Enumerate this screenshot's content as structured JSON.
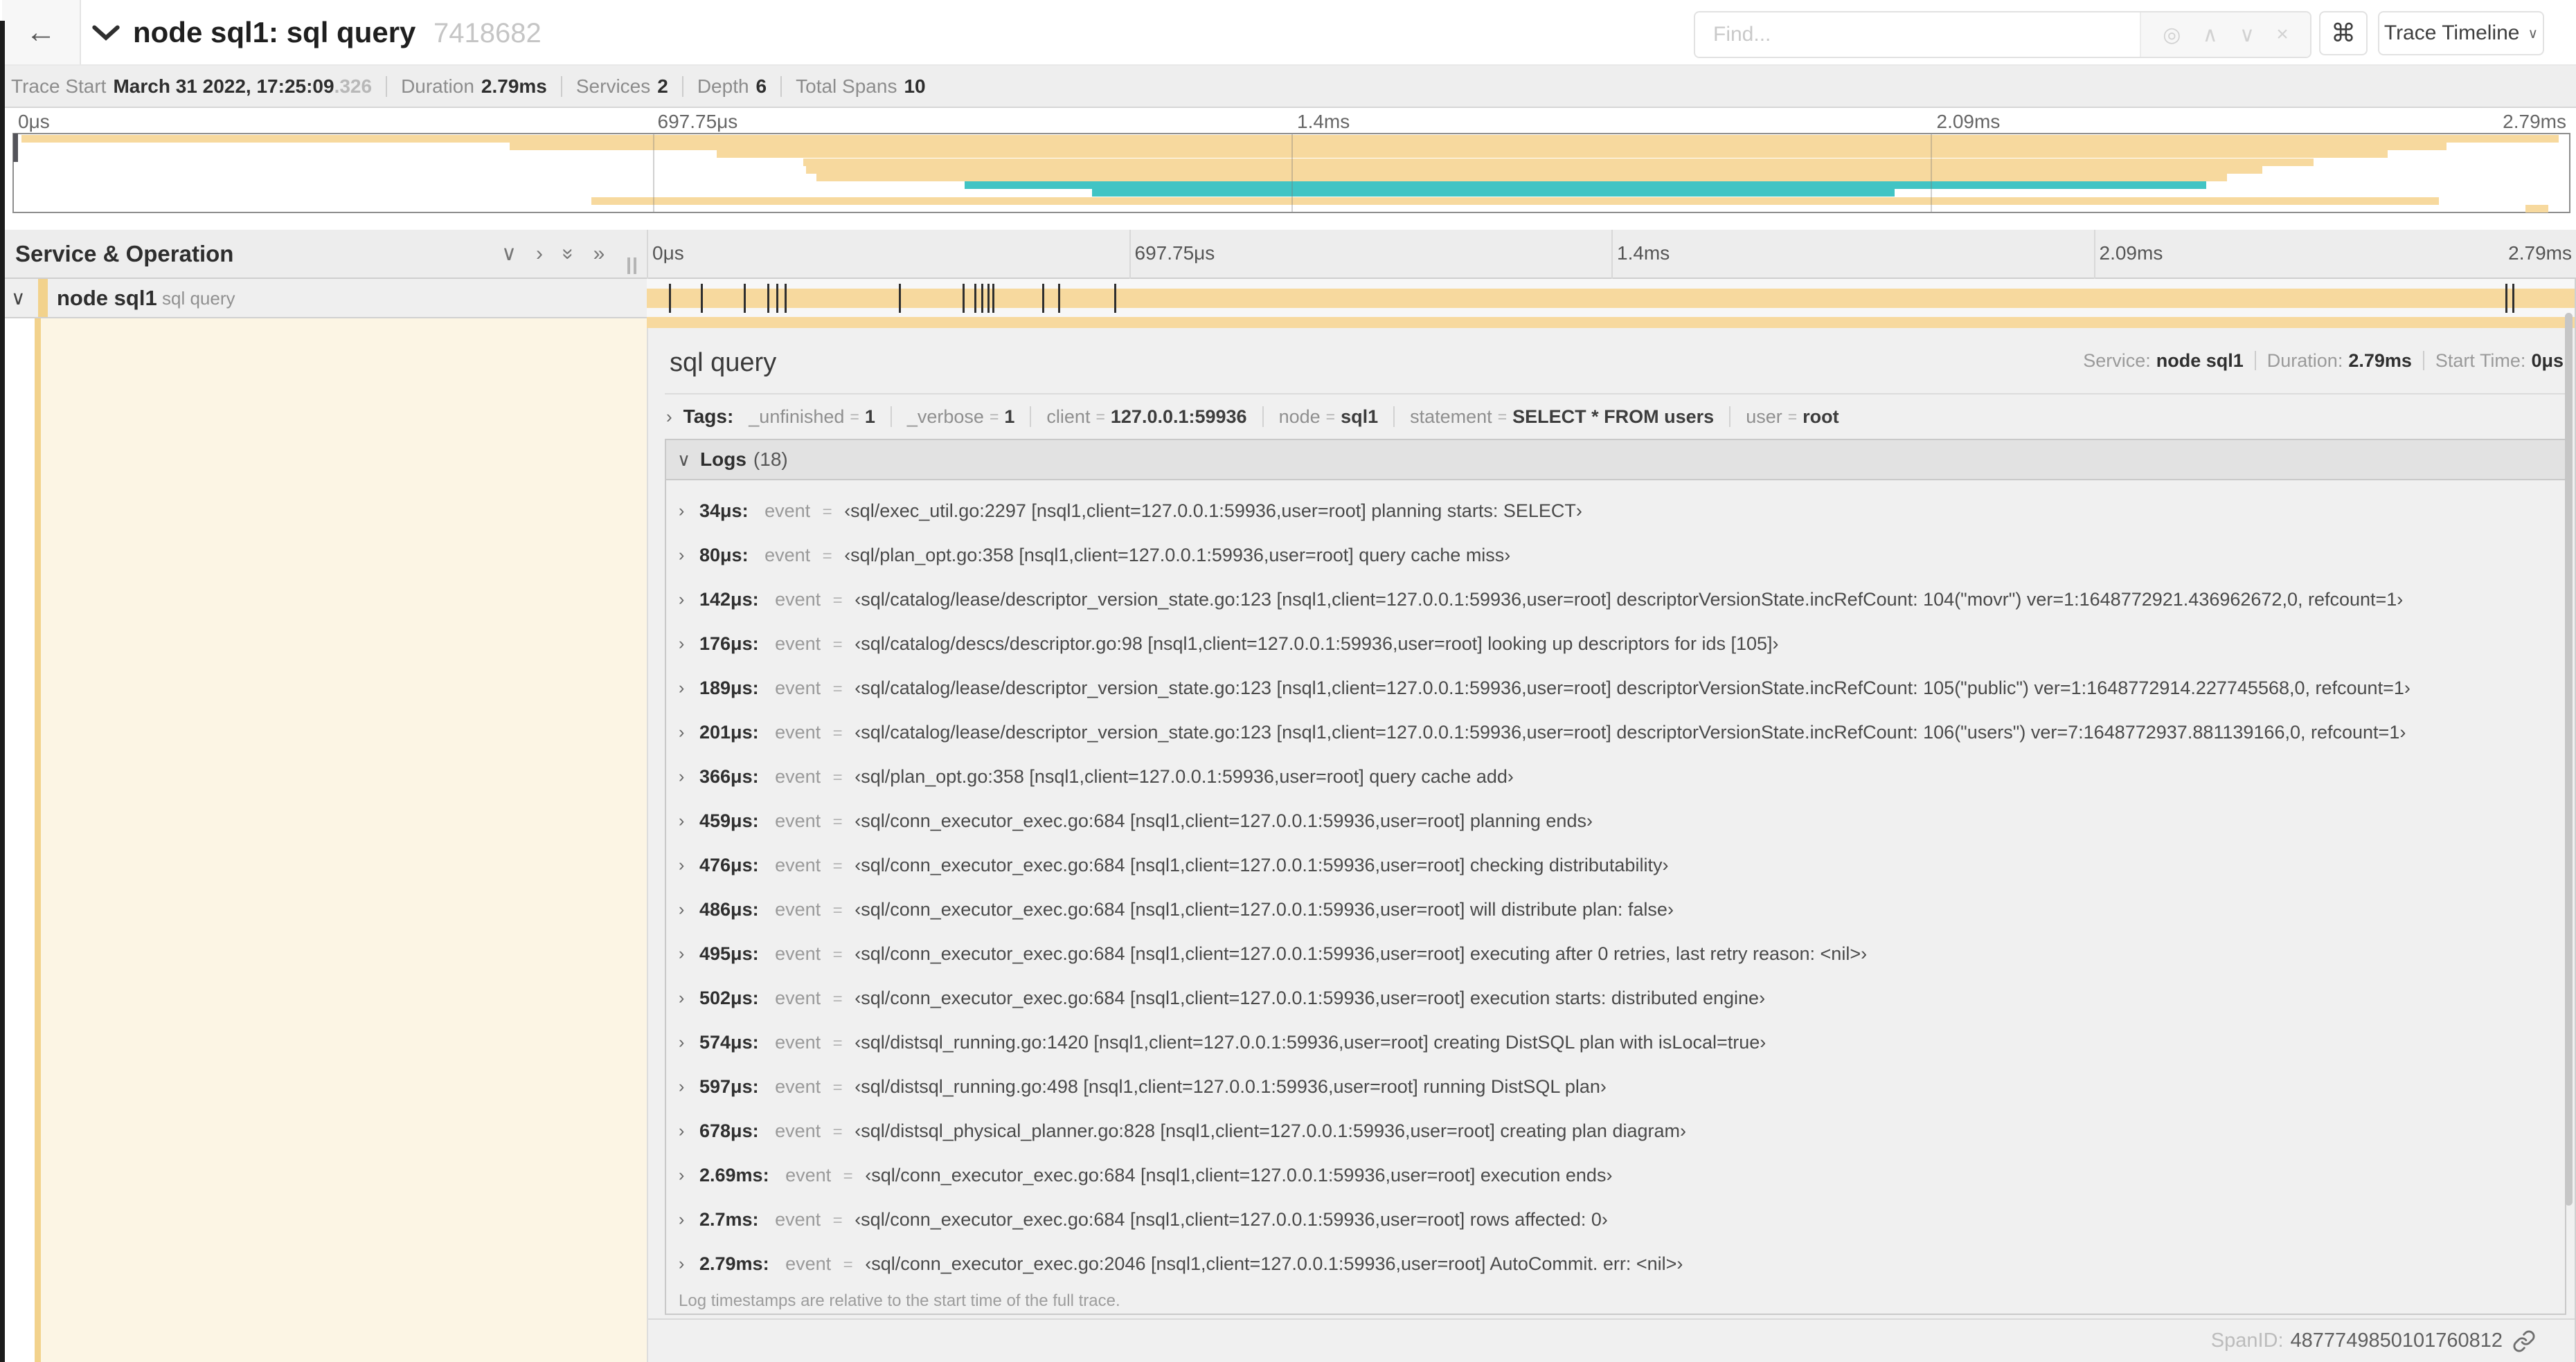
{
  "header": {
    "back_icon": "←",
    "title": "node sql1: sql query",
    "trace_id": "7418682",
    "find_placeholder": "Find...",
    "find_icons": {
      "locate": "◎",
      "prev": "∧",
      "next": "∨",
      "clear": "×"
    },
    "command_symbol": "⌘",
    "view_dropdown": "Trace Timeline",
    "view_caret": "∨"
  },
  "summary": {
    "items": [
      {
        "label": "Trace Start",
        "value": "March 31 2022, 17:25:09",
        "suffix": ".326"
      },
      {
        "label": "Duration",
        "value": "2.79ms"
      },
      {
        "label": "Services",
        "value": "2"
      },
      {
        "label": "Depth",
        "value": "6"
      },
      {
        "label": "Total Spans",
        "value": "10"
      }
    ]
  },
  "minimap": {
    "ticks": [
      "0μs",
      "697.75μs",
      "1.4ms",
      "2.09ms",
      "2.79ms"
    ],
    "spans": [
      {
        "start_pct": 0.3,
        "end_pct": 99.6,
        "color": "tan"
      },
      {
        "start_pct": 19.4,
        "end_pct": 95.2,
        "color": "tan"
      },
      {
        "start_pct": 27.5,
        "end_pct": 92.9,
        "color": "tan"
      },
      {
        "start_pct": 30.9,
        "end_pct": 90.0,
        "color": "tan"
      },
      {
        "start_pct": 31.0,
        "end_pct": 88.0,
        "color": "tan"
      },
      {
        "start_pct": 31.4,
        "end_pct": 86.6,
        "color": "tan"
      },
      {
        "start_pct": 37.2,
        "end_pct": 85.8,
        "color": "teal"
      },
      {
        "start_pct": 42.2,
        "end_pct": 73.6,
        "color": "teal"
      },
      {
        "start_pct": 22.6,
        "end_pct": 94.9,
        "color": "tan"
      },
      {
        "start_pct": 98.3,
        "end_pct": 99.2,
        "color": "tan"
      }
    ]
  },
  "timeline": {
    "left_header": "Service & Operation",
    "icons": {
      "collapse_one": "∨",
      "expand_one": "›",
      "collapse_all": "»",
      "expand_all": "»"
    },
    "ticks": [
      "0μs",
      "697.75μs",
      "1.4ms",
      "2.09ms",
      "2.79ms"
    ],
    "row": {
      "chevron": "∨",
      "service": "node sql1",
      "operation": "sql query"
    }
  },
  "detail": {
    "title": "sql query",
    "header_info": [
      {
        "label": "Service:",
        "value": "node sql1"
      },
      {
        "label": "Duration:",
        "value": "2.79ms"
      },
      {
        "label": "Start Time:",
        "value": "0μs"
      }
    ],
    "tags_chevron": "›",
    "tags_label": "Tags:",
    "tags": [
      {
        "key": "_unfinished",
        "value": "1"
      },
      {
        "key": "_verbose",
        "value": "1"
      },
      {
        "key": "client",
        "value": "127.0.0.1:59936"
      },
      {
        "key": "node",
        "value": "sql1"
      },
      {
        "key": "statement",
        "value": "SELECT * FROM users"
      },
      {
        "key": "user",
        "value": "root"
      }
    ],
    "logs_chevron": "∨",
    "logs_label": "Logs",
    "logs_count_display": "(18)",
    "log_word_event": "event",
    "log_word_eq": "=",
    "logs": [
      {
        "t": "34μs:",
        "pct": 1.22,
        "msg": "‹sql/exec_util.go:2297 [nsql1,client=127.0.0.1:59936,user=root] planning starts: SELECT›"
      },
      {
        "t": "80μs:",
        "pct": 2.87,
        "msg": "‹sql/plan_opt.go:358 [nsql1,client=127.0.0.1:59936,user=root] query cache miss›"
      },
      {
        "t": "142μs:",
        "pct": 5.09,
        "msg": "‹sql/catalog/lease/descriptor_version_state.go:123 [nsql1,client=127.0.0.1:59936,user=root] descriptorVersionState.incRefCount: 104(\"movr\") ver=1:1648772921.436962672,0, refcount=1›"
      },
      {
        "t": "176μs:",
        "pct": 6.31,
        "msg": "‹sql/catalog/descs/descriptor.go:98 [nsql1,client=127.0.0.1:59936,user=root] looking up descriptors for ids [105]›"
      },
      {
        "t": "189μs:",
        "pct": 6.77,
        "msg": "‹sql/catalog/lease/descriptor_version_state.go:123 [nsql1,client=127.0.0.1:59936,user=root] descriptorVersionState.incRefCount: 105(\"public\") ver=1:1648772914.227745568,0, refcount=1›"
      },
      {
        "t": "201μs:",
        "pct": 7.2,
        "msg": "‹sql/catalog/lease/descriptor_version_state.go:123 [nsql1,client=127.0.0.1:59936,user=root] descriptorVersionState.incRefCount: 106(\"users\") ver=7:1648772937.881139166,0, refcount=1›"
      },
      {
        "t": "366μs:",
        "pct": 13.12,
        "msg": "‹sql/plan_opt.go:358 [nsql1,client=127.0.0.1:59936,user=root] query cache add›"
      },
      {
        "t": "459μs:",
        "pct": 16.45,
        "msg": "‹sql/conn_executor_exec.go:684 [nsql1,client=127.0.0.1:59936,user=root] planning ends›"
      },
      {
        "t": "476μs:",
        "pct": 17.06,
        "msg": "‹sql/conn_executor_exec.go:684 [nsql1,client=127.0.0.1:59936,user=root] checking distributability›"
      },
      {
        "t": "486μs:",
        "pct": 17.42,
        "msg": "‹sql/conn_executor_exec.go:684 [nsql1,client=127.0.0.1:59936,user=root] will distribute plan: false›"
      },
      {
        "t": "495μs:",
        "pct": 17.74,
        "msg": "‹sql/conn_executor_exec.go:684 [nsql1,client=127.0.0.1:59936,user=root] executing after 0 retries, last retry reason: <nil>›"
      },
      {
        "t": "502μs:",
        "pct": 17.99,
        "msg": "‹sql/conn_executor_exec.go:684 [nsql1,client=127.0.0.1:59936,user=root] execution starts: distributed engine›"
      },
      {
        "t": "574μs:",
        "pct": 20.57,
        "msg": "‹sql/distsql_running.go:1420 [nsql1,client=127.0.0.1:59936,user=root] creating DistSQL plan with isLocal=true›"
      },
      {
        "t": "597μs:",
        "pct": 21.4,
        "msg": "‹sql/distsql_running.go:498 [nsql1,client=127.0.0.1:59936,user=root] running DistSQL plan›"
      },
      {
        "t": "678μs:",
        "pct": 24.3,
        "msg": "‹sql/distsql_physical_planner.go:828 [nsql1,client=127.0.0.1:59936,user=root] creating plan diagram›"
      },
      {
        "t": "2.69ms:",
        "pct": 96.42,
        "msg": "‹sql/conn_executor_exec.go:684 [nsql1,client=127.0.0.1:59936,user=root] execution ends›"
      },
      {
        "t": "2.7ms:",
        "pct": 96.77,
        "msg": "‹sql/conn_executor_exec.go:684 [nsql1,client=127.0.0.1:59936,user=root] rows affected: 0›"
      },
      {
        "t": "2.79ms:",
        "pct": 100,
        "msg": "‹sql/conn_executor_exec.go:2046 [nsql1,client=127.0.0.1:59936,user=root] AutoCommit. err: <nil>›"
      }
    ],
    "logs_note": "Log timestamps are relative to the start time of the full trace.",
    "spanid_label": "SpanID:",
    "spanid_value": "4877749850101760812"
  },
  "colors": {
    "tan": "#f7d99e",
    "teal": "#41c4c4",
    "strip": "#f2d28c",
    "cream": "#fcf5e4"
  }
}
